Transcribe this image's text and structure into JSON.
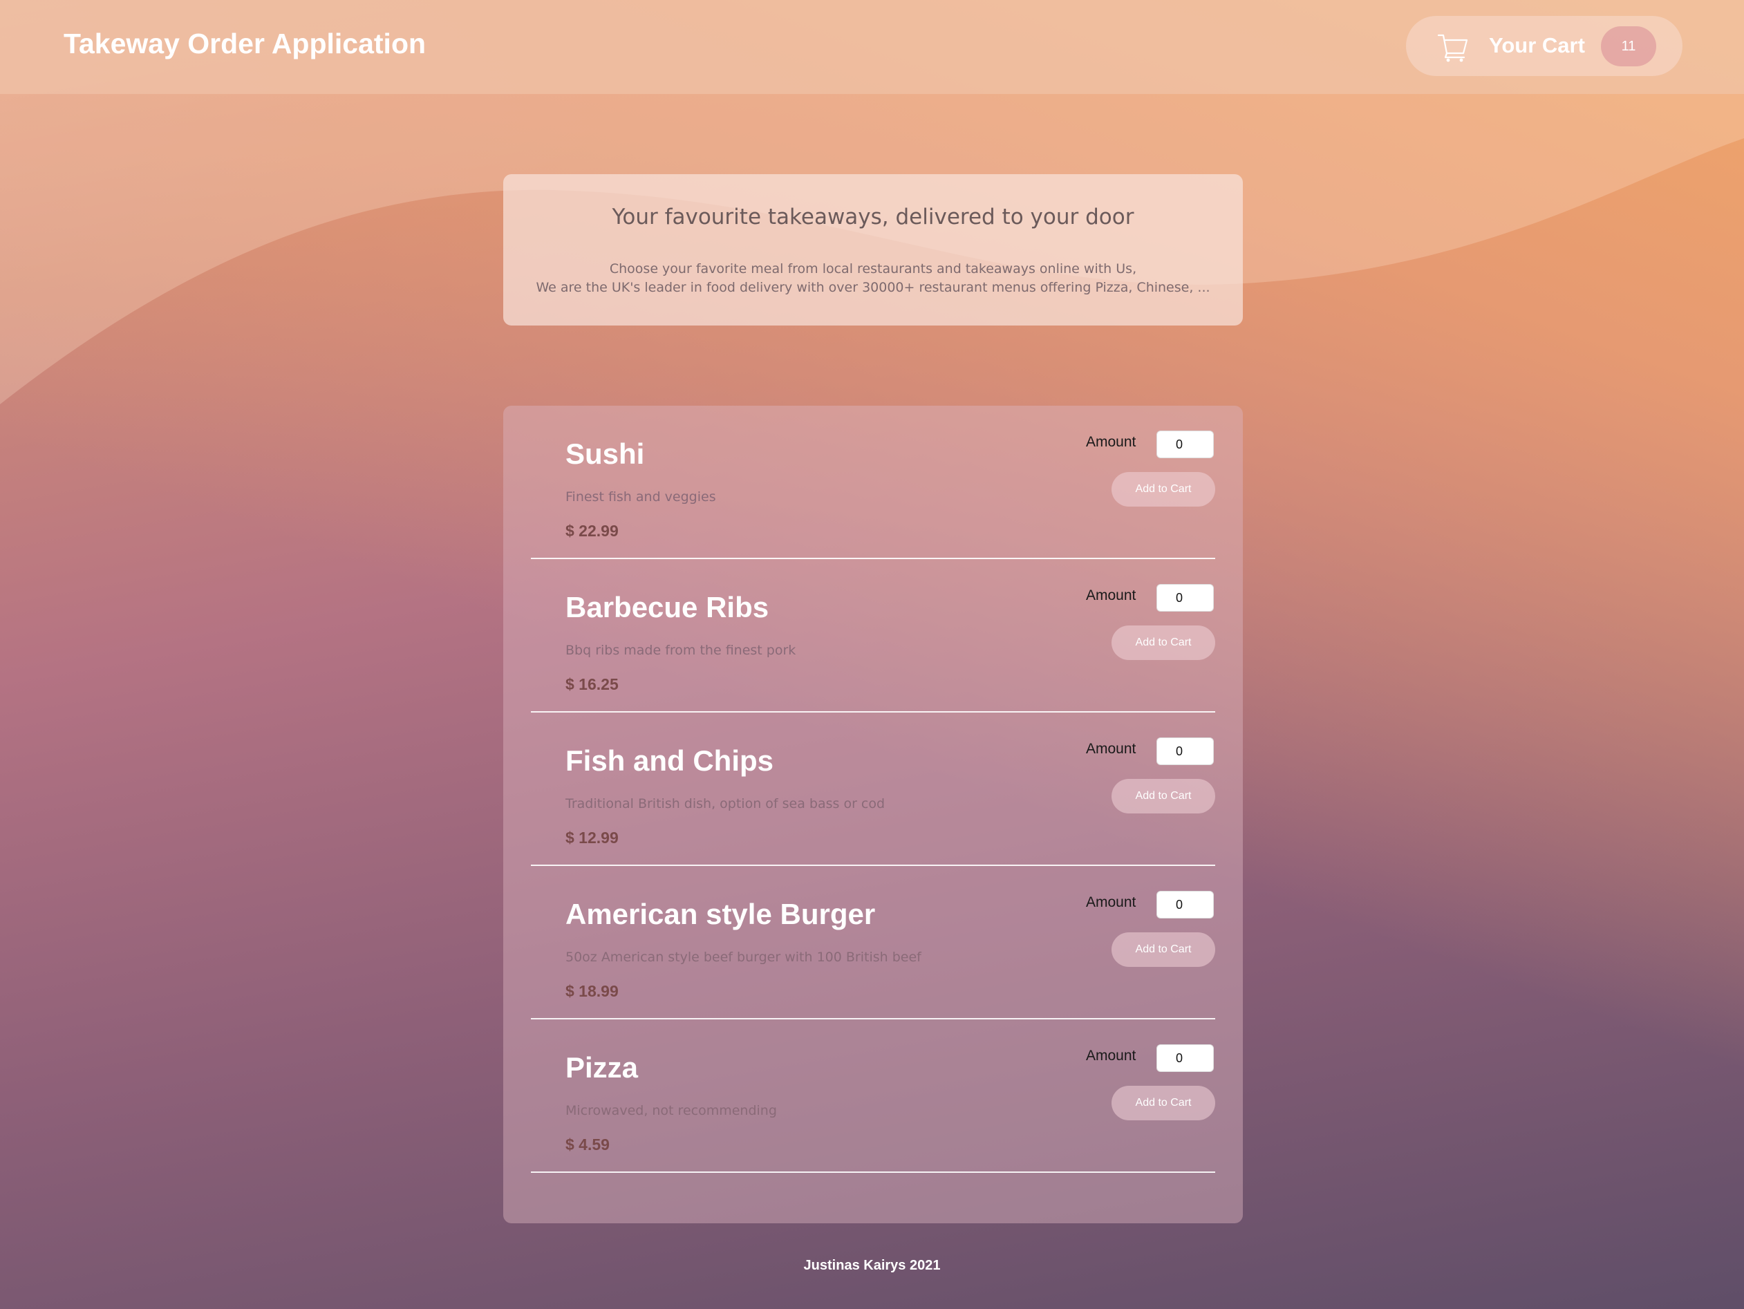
{
  "header": {
    "app_title": "Takeway Order Application",
    "cart_label": "Your Cart",
    "cart_count": "11",
    "cart_icon": "shopping-cart-icon"
  },
  "intro": {
    "heading": "Your favourite takeaways, delivered to your door",
    "line1": "Choose your favorite meal from local restaurants and takeaways online with Us,",
    "line2": "We are the UK's leader in food delivery with over 30000+ restaurant menus offering Pizza, Chinese, ..."
  },
  "menu": {
    "items": [
      {
        "name": "Sushi",
        "description": "Finest fish and veggies",
        "price": "$ 22.99",
        "amount_label": "Amount",
        "amount_value": "0",
        "button_label": "Add to Cart"
      },
      {
        "name": "Barbecue Ribs",
        "description": "Bbq ribs made from the finest pork",
        "price": "$ 16.25",
        "amount_label": "Amount",
        "amount_value": "0",
        "button_label": "Add to Cart"
      },
      {
        "name": "Fish and Chips",
        "description": "Traditional British dish, option of sea bass or cod",
        "price": "$ 12.99",
        "amount_label": "Amount",
        "amount_value": "0",
        "button_label": "Add to Cart"
      },
      {
        "name": "American style Burger",
        "description": "50oz American style beef burger with 100 British beef",
        "price": "$ 18.99",
        "amount_label": "Amount",
        "amount_value": "0",
        "button_label": "Add to Cart"
      },
      {
        "name": "Pizza",
        "description": "Microwaved, not recommending",
        "price": "$ 4.59",
        "amount_label": "Amount",
        "amount_value": "0",
        "button_label": "Add to Cart"
      }
    ]
  },
  "footer": {
    "text": "Justinas Kairys 2021"
  },
  "colors": {
    "accent": "#f0a66a",
    "background_bottom": "#5f4e68",
    "price": "#7a4a4a"
  }
}
